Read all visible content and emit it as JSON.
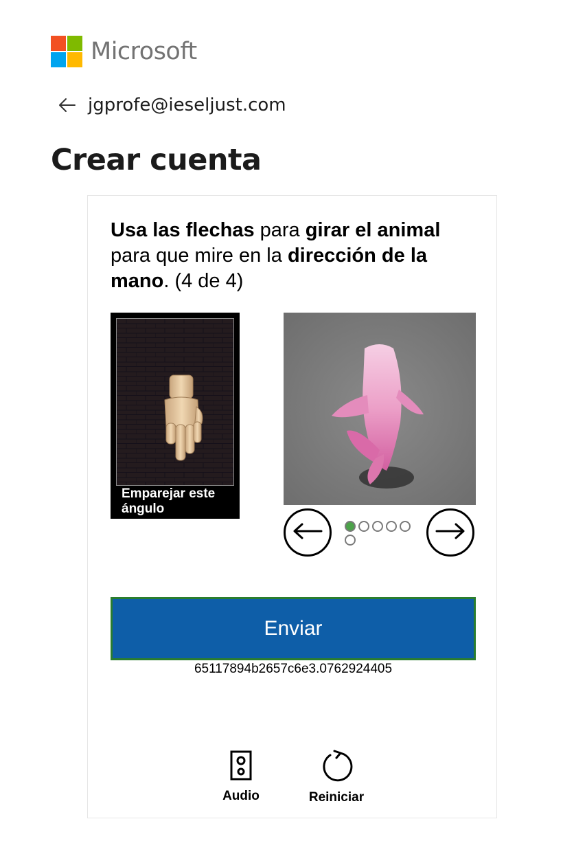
{
  "brand": {
    "name": "Microsoft",
    "logo_colors": [
      "#f25022",
      "#7fba00",
      "#00a4ef",
      "#ffb900"
    ]
  },
  "identity": {
    "email": "jgprofe@ieseljust.com",
    "back_icon": "back-arrow-icon"
  },
  "page": {
    "title": "Crear cuenta"
  },
  "challenge": {
    "instruction_parts": [
      {
        "text": "Usa las flechas",
        "bold": true
      },
      {
        "text": " para ",
        "bold": false
      },
      {
        "text": "girar el animal",
        "bold": true
      },
      {
        "text": " para que mire en la ",
        "bold": false
      },
      {
        "text": "dirección de la mano",
        "bold": true
      },
      {
        "text": ". (4 de 4)",
        "bold": false
      }
    ],
    "target_label": "Emparejar este ángulo",
    "target_icon": "pointing-hand-image",
    "animal_icon": "pink-animal-image",
    "prev_icon": "arrow-left-icon",
    "next_icon": "arrow-right-icon",
    "pagination": {
      "total": 6,
      "current": 1,
      "active_color": "#4ca24a"
    },
    "submit_label": "Enviar",
    "session_id": "65117894b2657c6e3.0762924405",
    "colors": {
      "submit_bg": "#0e5ea8",
      "submit_border": "#2a7d2f"
    }
  },
  "toolbar": {
    "audio_label": "Audio",
    "audio_icon": "speaker-icon",
    "reset_label": "Reiniciar",
    "reset_icon": "refresh-icon"
  }
}
